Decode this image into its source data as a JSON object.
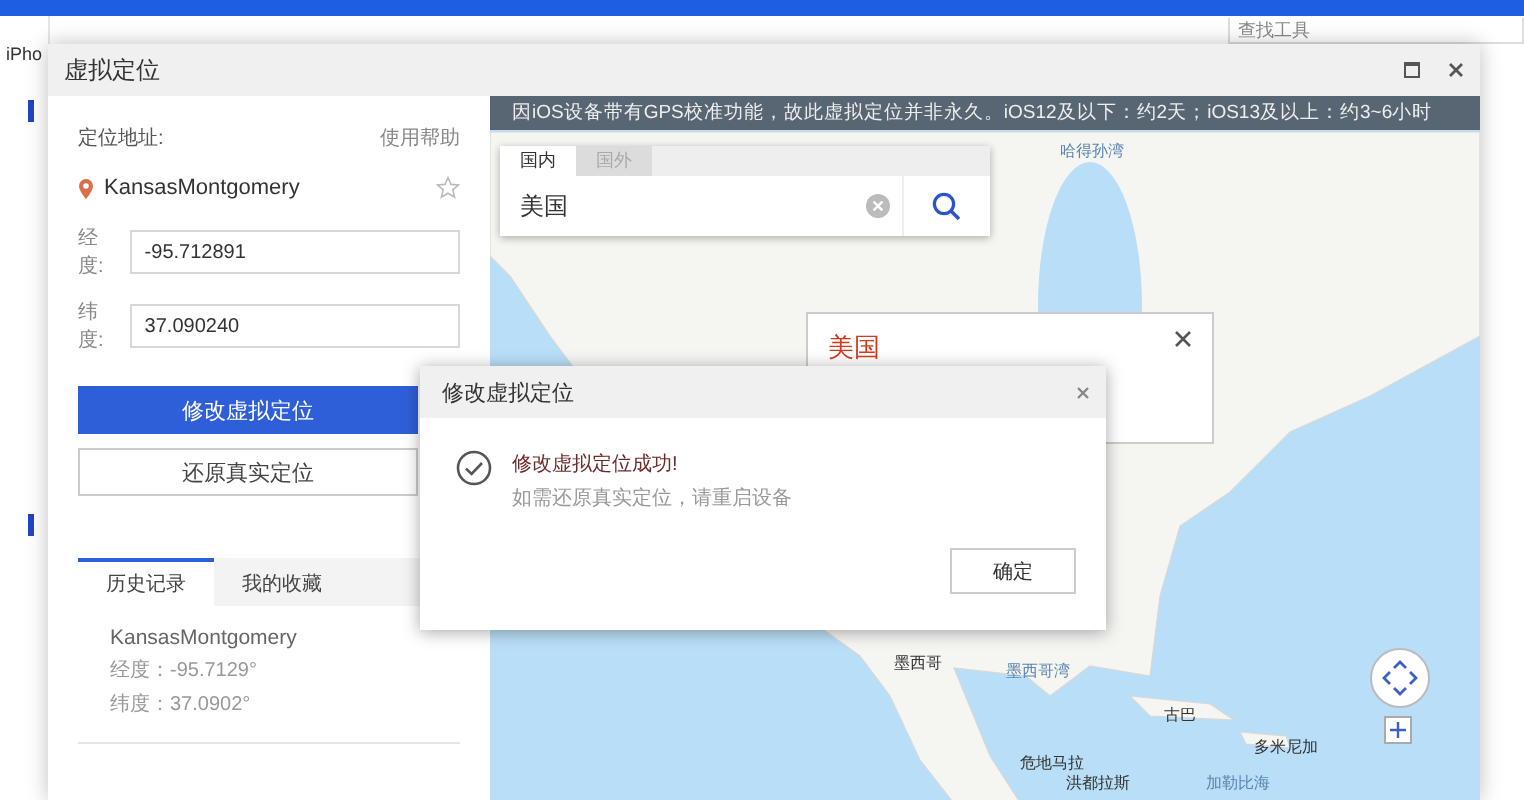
{
  "app": {
    "device_tab": "iPho",
    "search": {
      "placeholder": "查找工具"
    }
  },
  "window": {
    "title": "虚拟定位"
  },
  "location": {
    "label": "定位地址:",
    "help_link": "使用帮助",
    "name": "KansasMontgomery",
    "favorited": false,
    "longitude": {
      "label": "经度:",
      "value": "-95.712891"
    },
    "latitude": {
      "label": "纬度:",
      "value": "37.090240"
    }
  },
  "buttons": [
    {
      "label": "修改虚拟定位",
      "kind": "primary"
    },
    {
      "label": "还原真实定位",
      "kind": "secondary"
    }
  ],
  "history_tabs": [
    {
      "label": "历史记录",
      "selected": true
    },
    {
      "label": "我的收藏",
      "selected": false
    }
  ],
  "history": [
    {
      "name": "KansasMontgomery",
      "longitude": "经度：-95.7129°",
      "latitude": "纬度：37.0902°"
    }
  ],
  "map": {
    "notice": "因iOS设备带有GPS校准功能，故此虚拟定位并非永久。iOS12及以下：约2天；iOS13及以上：约3~6小时",
    "search": {
      "tabs": [
        {
          "label": "国内",
          "selected": true
        },
        {
          "label": "国外",
          "selected": false
        }
      ],
      "value": "美国"
    },
    "popup": {
      "title": "美国"
    },
    "labels": [
      {
        "text": "哈得孙湾",
        "kind": "water"
      },
      {
        "text": "墨西哥",
        "kind": "land"
      },
      {
        "text": "墨西哥湾",
        "kind": "water"
      },
      {
        "text": "古巴",
        "kind": "land"
      },
      {
        "text": "多米尼加",
        "kind": "land"
      },
      {
        "text": "危地马拉",
        "kind": "land"
      },
      {
        "text": "洪都拉斯",
        "kind": "land"
      },
      {
        "text": "加勒比海",
        "kind": "water"
      }
    ]
  },
  "dialog": {
    "title": "修改虚拟定位",
    "message": "修改虚拟定位成功!",
    "detail": "如需还原真实定位，请重启设备",
    "button": "确定"
  }
}
